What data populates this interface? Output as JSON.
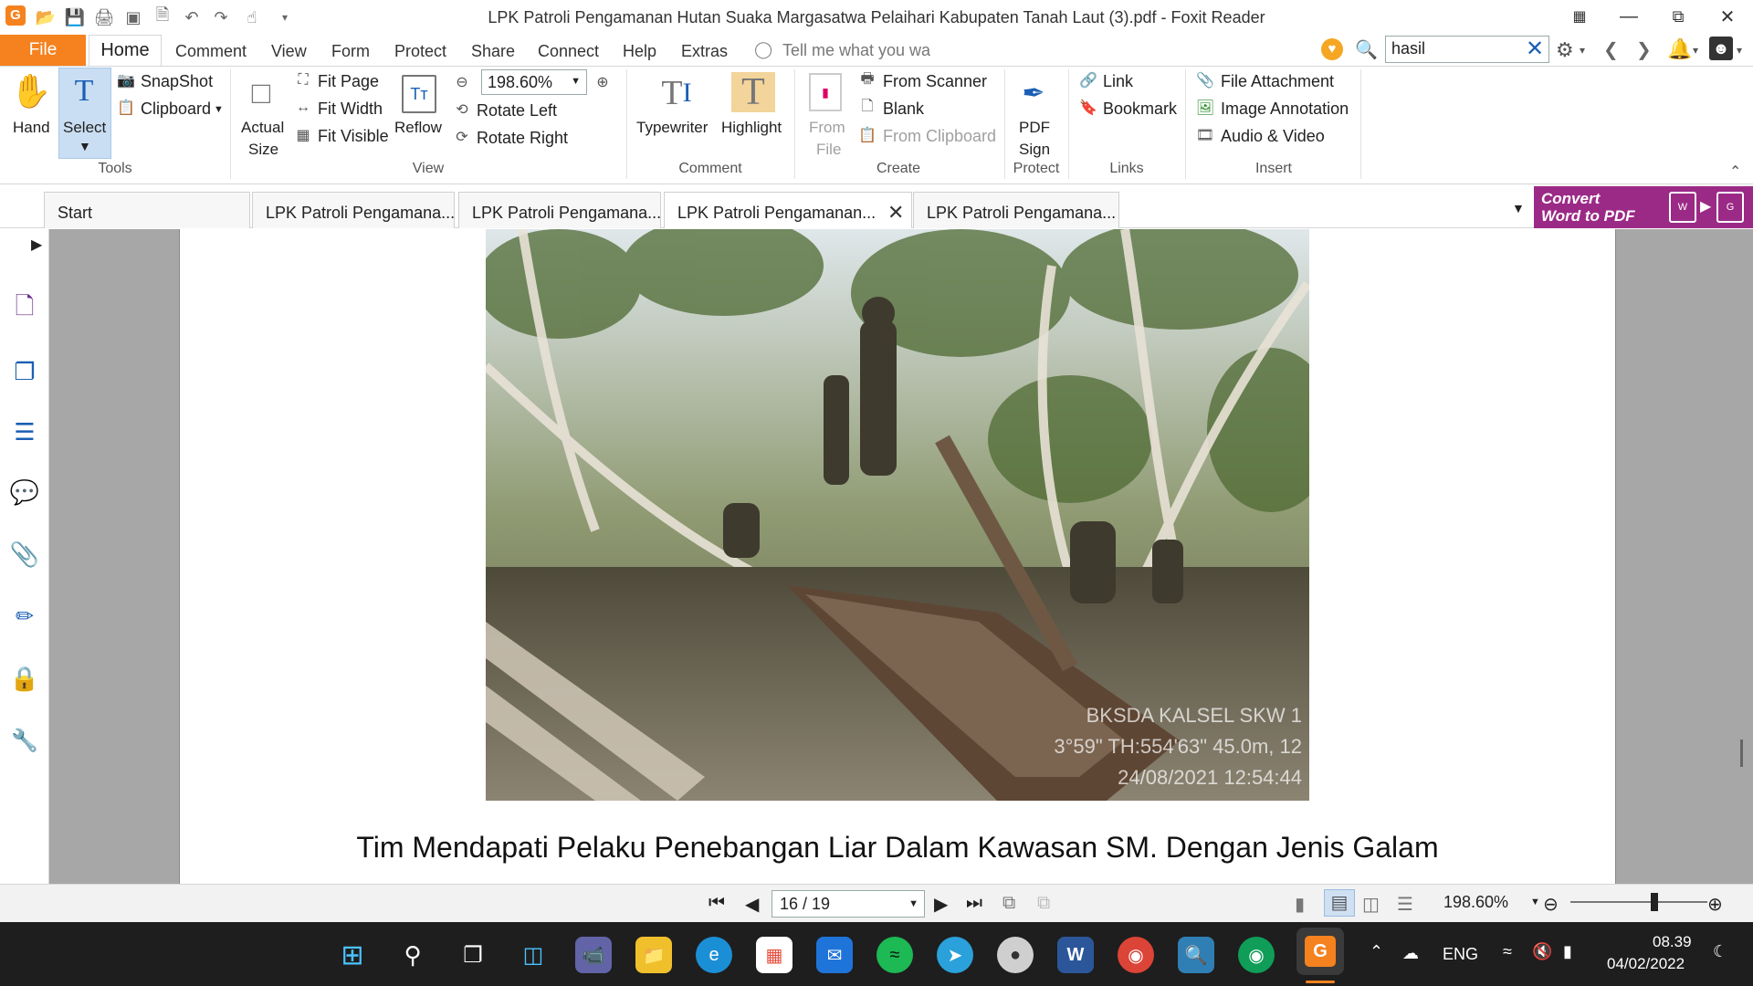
{
  "window": {
    "title": "LPK Patroli Pengamanan Hutan Suaka Margasatwa Pelaihari Kabupaten Tanah Laut (3).pdf - Foxit Reader"
  },
  "menu": {
    "file": "File",
    "items": [
      "Home",
      "Comment",
      "View",
      "Form",
      "Protect",
      "Share",
      "Connect",
      "Help",
      "Extras"
    ],
    "tell_me": "Tell me what you wa",
    "search_value": "hasil"
  },
  "ribbon": {
    "tools": {
      "hand": "Hand",
      "select": "Select",
      "snapshot": "SnapShot",
      "clipboard": "Clipboard",
      "group": "Tools"
    },
    "view": {
      "actual_size_1": "Actual",
      "actual_size_2": "Size",
      "fit_page": "Fit Page",
      "fit_width": "Fit Width",
      "fit_visible": "Fit Visible",
      "reflow": "Reflow",
      "zoom": "198.60%",
      "rotate_left": "Rotate Left",
      "rotate_right": "Rotate Right",
      "group": "View"
    },
    "comment": {
      "typewriter": "Typewriter",
      "highlight": "Highlight",
      "group": "Comment"
    },
    "create": {
      "from_file_1": "From",
      "from_file_2": "File",
      "from_scanner": "From Scanner",
      "blank": "Blank",
      "from_clipboard": "From Clipboard",
      "group": "Create"
    },
    "protect": {
      "pdf_sign_1": "PDF",
      "pdf_sign_2": "Sign",
      "group": "Protect"
    },
    "links": {
      "link": "Link",
      "bookmark": "Bookmark",
      "group": "Links"
    },
    "insert": {
      "file_attachment": "File Attachment",
      "image_annotation": "Image Annotation",
      "audio_video": "Audio & Video",
      "group": "Insert"
    }
  },
  "tabs": [
    "Start",
    "LPK Patroli Pengamana...",
    "LPK Patroli Pengamana...",
    "LPK Patroli Pengamanan...",
    "LPK Patroli Pengamana..."
  ],
  "convert_banner": {
    "line1": "Convert",
    "line2": "Word to PDF"
  },
  "document": {
    "photo_watermark": [
      "BKSDA KALSEL SKW 1",
      "3°59\" TH:554'63\" 45.0m, 12",
      "24/08/2021 12:54:44"
    ],
    "caption": "Tim Mendapati Pelaku Penebangan Liar Dalam Kawasan SM. Dengan Jenis Galam"
  },
  "status": {
    "page": "16 / 19",
    "zoom": "198.60%"
  },
  "taskbar": {
    "lang": "ENG",
    "time": "08.39",
    "date": "04/02/2022"
  },
  "colors": {
    "file_tab": "#f5821f",
    "select_active": "#c9def2",
    "convert_banner": "#9b2a86",
    "taskbar": "#1e1e1e"
  }
}
